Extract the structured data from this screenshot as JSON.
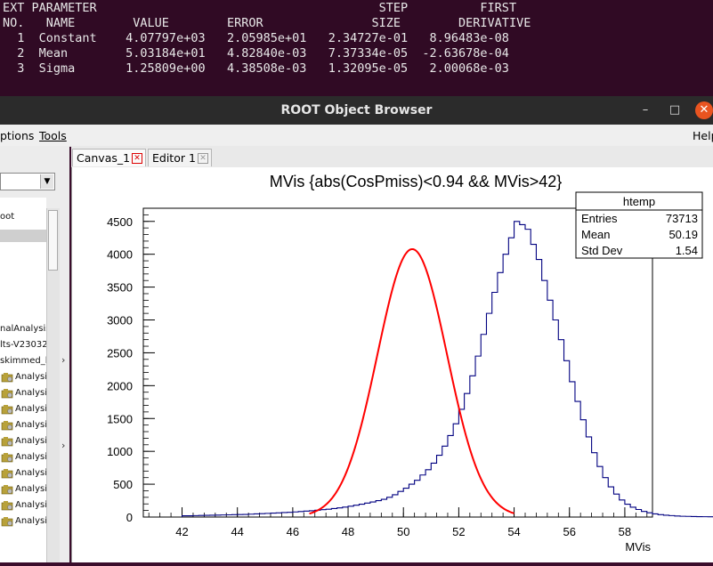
{
  "terminal": {
    "header1": [
      "EXT",
      "PARAMETER",
      "STEP",
      "FIRST"
    ],
    "header2": [
      "NO.",
      "NAME",
      "VALUE",
      "ERROR",
      "SIZE",
      "DERIVATIVE"
    ],
    "rows": [
      {
        "no": "1",
        "name": "Constant",
        "value": "4.07797e+03",
        "error": "2.05985e+01",
        "step": "2.34727e-01",
        "deriv": "8.96483e-08"
      },
      {
        "no": "2",
        "name": "Mean",
        "value": "5.03184e+01",
        "error": "4.82840e-03",
        "step": "7.37334e-05",
        "deriv": "-2.63678e-04"
      },
      {
        "no": "3",
        "name": "Sigma",
        "value": "1.25809e+00",
        "error": "4.38508e-03",
        "step": "1.32095e-05",
        "deriv": "2.00068e-03"
      }
    ]
  },
  "window": {
    "title": "ROOT Object Browser",
    "minimize": "–",
    "maximize": "□",
    "close": "✕"
  },
  "menu": {
    "options": "ptions",
    "tools": "Tools",
    "help": "Help"
  },
  "tree": {
    "items": [
      "oot",
      "nalAnalysis",
      "lts-V23032",
      "skimmed_l",
      "Analysi",
      "Analysi",
      "Analysi",
      "Analysi",
      "Analysi",
      "Analysi",
      "Analysi",
      "Analysi",
      "Analysi",
      "Analysi"
    ]
  },
  "tabs": [
    {
      "label": "Canvas_1"
    },
    {
      "label": "Editor 1"
    }
  ],
  "stats": {
    "title": "htemp",
    "rows": [
      {
        "label": "Entries",
        "value": "73713"
      },
      {
        "label": "Mean",
        "value": "50.19"
      },
      {
        "label": "Std Dev",
        "value": "1.54"
      }
    ]
  },
  "chart_data": {
    "type": "histogram",
    "title": "MVis {abs(CosPmiss)<0.94 && MVis>42}",
    "xlabel": "MVis",
    "ylabel": "",
    "xlim": [
      40.6,
      59.0
    ],
    "ylim": [
      0,
      4700
    ],
    "xticks": [
      42,
      44,
      46,
      48,
      50,
      52,
      54,
      56,
      58
    ],
    "yticks": [
      0,
      500,
      1000,
      1500,
      2000,
      2500,
      3000,
      3500,
      4000,
      4500
    ],
    "histogram_color": "#000080",
    "fit_color": "#ff0000",
    "bins": {
      "x_start": 42.0,
      "width": 0.2,
      "counts": [
        20,
        20,
        22,
        24,
        26,
        28,
        30,
        32,
        34,
        36,
        38,
        40,
        44,
        48,
        52,
        56,
        60,
        64,
        68,
        72,
        78,
        84,
        90,
        96,
        104,
        112,
        120,
        130,
        140,
        152,
        165,
        180,
        195,
        212,
        230,
        250,
        270,
        300,
        340,
        390,
        440,
        500,
        560,
        640,
        720,
        820,
        940,
        1080,
        1240,
        1420,
        1640,
        1880,
        2150,
        2450,
        2780,
        3100,
        3420,
        3720,
        4000,
        4250,
        4500,
        4450,
        4380,
        4150,
        3920,
        3600,
        3300,
        3000,
        2700,
        2380,
        2060,
        1760,
        1480,
        1220,
        980,
        770,
        600,
        460,
        350,
        260,
        195,
        150,
        115,
        85,
        65,
        48,
        36,
        28,
        22,
        16,
        12,
        10,
        8,
        6,
        5,
        4,
        3,
        2,
        2,
        1,
        1,
        1,
        0
      ]
    },
    "fit": {
      "function": "gaus",
      "constant": 4077.97,
      "mean": 50.3184,
      "sigma": 1.25809,
      "range": [
        46.6,
        54.0
      ]
    }
  }
}
